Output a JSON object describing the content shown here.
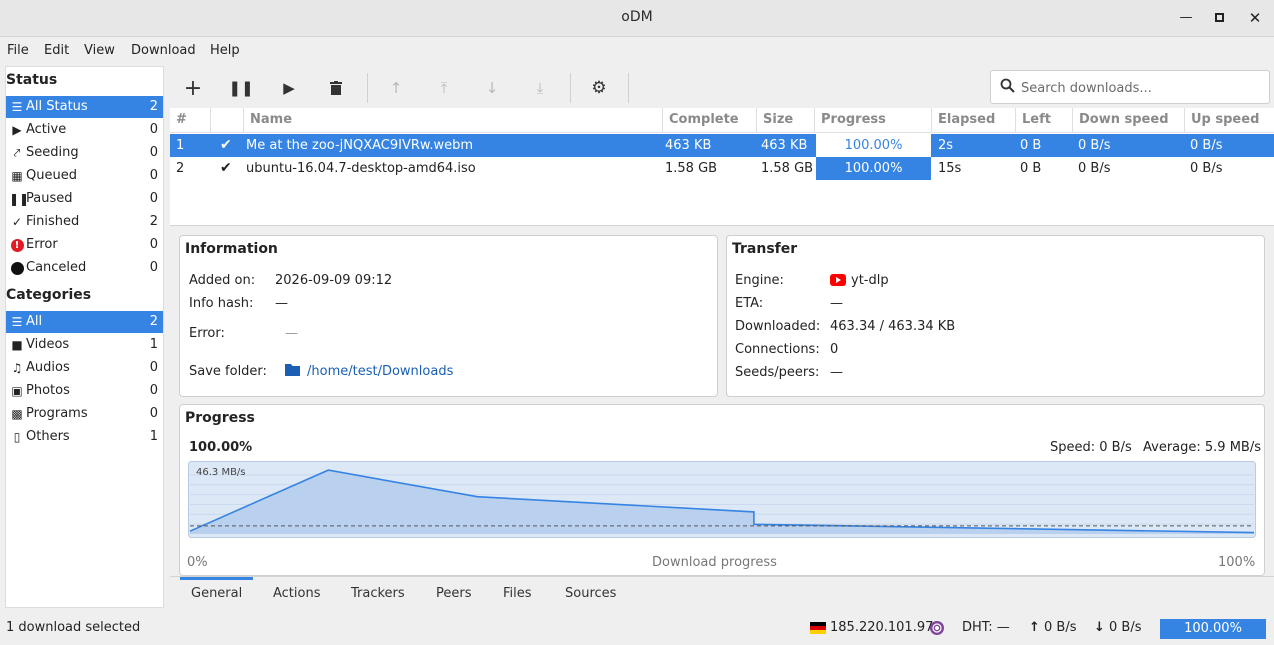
{
  "window": {
    "title": "oDM"
  },
  "menu": [
    "File",
    "Edit",
    "View",
    "Download",
    "Help"
  ],
  "sidebar": {
    "status_heading": "Status",
    "status": [
      {
        "label": "All Status",
        "count": "2",
        "icon": "list-icon"
      },
      {
        "label": "Active",
        "count": "0",
        "icon": "play-icon"
      },
      {
        "label": "Seeding",
        "count": "0",
        "icon": "seed-icon"
      },
      {
        "label": "Queued",
        "count": "0",
        "icon": "grid-icon"
      },
      {
        "label": "Paused",
        "count": "0",
        "icon": "pause-icon"
      },
      {
        "label": "Finished",
        "count": "2",
        "icon": "check-icon"
      },
      {
        "label": "Error",
        "count": "0",
        "icon": "error-icon"
      },
      {
        "label": "Canceled",
        "count": "0",
        "icon": "cancel-icon"
      }
    ],
    "categories_heading": "Categories",
    "categories": [
      {
        "label": "All",
        "count": "2",
        "icon": "list-icon"
      },
      {
        "label": "Videos",
        "count": "1",
        "icon": "video-icon"
      },
      {
        "label": "Audios",
        "count": "0",
        "icon": "music-icon"
      },
      {
        "label": "Photos",
        "count": "0",
        "icon": "photo-icon"
      },
      {
        "label": "Programs",
        "count": "0",
        "icon": "program-icon"
      },
      {
        "label": "Others",
        "count": "1",
        "icon": "file-icon"
      }
    ]
  },
  "search": {
    "placeholder": "Search downloads..."
  },
  "table": {
    "headers": [
      "#",
      "",
      "Name",
      "Complete",
      "Size",
      "Progress",
      "Elapsed",
      "Left",
      "Down speed",
      "Up speed"
    ],
    "rows": [
      {
        "num": "1",
        "name": "Me at the zoo-jNQXAC9IVRw.webm",
        "complete": "463 KB",
        "size": "463 KB",
        "progress": "100.00%",
        "progress_value": 1.0,
        "elapsed": "2s",
        "left": "0 B",
        "down": "0 B/s",
        "up": "0 B/s"
      },
      {
        "num": "2",
        "name": "ubuntu-16.04.7-desktop-amd64.iso",
        "complete": "1.58 GB",
        "size": "1.58 GB",
        "progress": "100.00%",
        "progress_value": 1.0,
        "elapsed": "15s",
        "left": "0 B",
        "down": "0 B/s",
        "up": "0 B/s"
      }
    ]
  },
  "info": {
    "title": "Information",
    "added_label": "Added on:",
    "added": "2026-09-09 09:12",
    "hash_label": "Info hash:",
    "hash": "—",
    "error_label": "Error:",
    "error": "—",
    "folder_label": "Save folder:",
    "folder": "/home/test/Downloads"
  },
  "transfer": {
    "title": "Transfer",
    "engine_label": "Engine:",
    "engine": "yt-dlp",
    "eta_label": "ETA:",
    "eta": "—",
    "downloaded_label": "Downloaded:",
    "downloaded": "463.34 / 463.34 KB",
    "connections_label": "Connections:",
    "connections": "0",
    "seeds_label": "Seeds/peers:",
    "seeds": "—"
  },
  "progress": {
    "title": "Progress",
    "percent": "100.00%",
    "speed": "Speed: 0 B/s",
    "average": "Average: 5.9 MB/s",
    "peak_label": "46.3 MB/s",
    "x_start": "0%",
    "x_mid": "Download progress",
    "x_end": "100%"
  },
  "chart_data": {
    "type": "area",
    "x": [
      0,
      13,
      27,
      53,
      53,
      100
    ],
    "y": [
      2,
      46.3,
      27,
      16,
      7,
      1
    ],
    "ylim": [
      0,
      50
    ],
    "average": 5.9,
    "xlabel": "Download progress"
  },
  "tabs": [
    "General",
    "Actions",
    "Trackers",
    "Peers",
    "Files",
    "Sources"
  ],
  "status": {
    "selected": "1 download selected",
    "ip": "185.220.101.97",
    "dht": "DHT: —",
    "up": "0 B/s",
    "down": "0 B/s",
    "total": "100.00%"
  },
  "colors": {
    "accent": "#3584e4",
    "link": "#1a5fb4",
    "error": "#e01b24",
    "youtube": "#ff0000"
  }
}
